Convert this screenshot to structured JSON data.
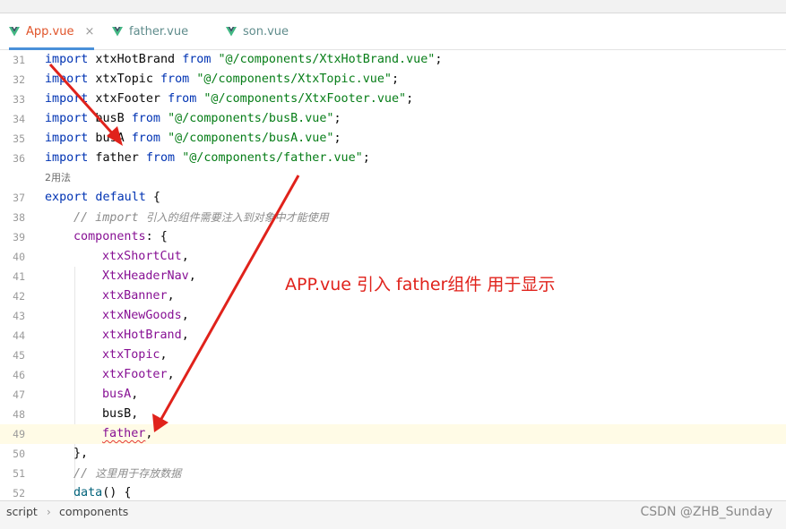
{
  "tabs": [
    {
      "label": "App.vue",
      "active": true,
      "close": "×"
    },
    {
      "label": "father.vue",
      "active": false
    },
    {
      "label": "son.vue",
      "active": false
    }
  ],
  "code": {
    "l31": {
      "num": "31",
      "kw": "import",
      "id": " xtxHotBrand ",
      "from": "from",
      "str": "\"@/components/XtxHotBrand.vue\"",
      "end": ";"
    },
    "l32": {
      "num": "32",
      "kw": "import",
      "id": " xtxTopic ",
      "from": "from",
      "str": "\"@/components/XtxTopic.vue\"",
      "end": ";"
    },
    "l33": {
      "num": "33",
      "kw": "import",
      "id": " xtxFooter ",
      "from": "from",
      "str": "\"@/components/XtxFooter.vue\"",
      "end": ";"
    },
    "l34": {
      "num": "34",
      "kw": "import",
      "id": " busB ",
      "from": "from",
      "str": "\"@/components/busB.vue\"",
      "end": ";"
    },
    "l35": {
      "num": "35",
      "kw": "import",
      "id": " busA ",
      "from": "from",
      "str": "\"@/components/busA.vue\"",
      "end": ";"
    },
    "l36": {
      "num": "36",
      "kw": "import",
      "id": " father ",
      "from": "from",
      "str": "\"@/components/father.vue\"",
      "end": ";"
    },
    "usages": "2用法",
    "l37": {
      "num": "37",
      "kw1": "export",
      "kw2": " default",
      "rest": " {"
    },
    "l38": {
      "num": "38",
      "comment": "// import ",
      "comment_zh": "引入的组件需要注入到对象中才能使用"
    },
    "l39": {
      "num": "39",
      "prop": "components",
      "rest": ": {"
    },
    "l40": {
      "num": "40",
      "name": "xtxShortCut",
      "sep": ","
    },
    "l41": {
      "num": "41",
      "name": "XtxHeaderNav",
      "sep": ","
    },
    "l42": {
      "num": "42",
      "name": "xtxBanner",
      "sep": ","
    },
    "l43": {
      "num": "43",
      "name": "xtxNewGoods",
      "sep": ","
    },
    "l44": {
      "num": "44",
      "name": "xtxHotBrand",
      "sep": ","
    },
    "l45": {
      "num": "45",
      "name": "xtxTopic",
      "sep": ","
    },
    "l46": {
      "num": "46",
      "name": "xtxFooter",
      "sep": ","
    },
    "l47": {
      "num": "47",
      "name": "busA",
      "sep": ","
    },
    "l48": {
      "num": "48",
      "name": "busB",
      "sep": ","
    },
    "l49": {
      "num": "49",
      "name": "father",
      "sep": ","
    },
    "l50": {
      "num": "50",
      "text": "},"
    },
    "l51": {
      "num": "51",
      "comment": "// ",
      "comment_zh": "这里用于存放数据"
    },
    "l52": {
      "num": "52",
      "fn": "data",
      "rest": "() {"
    }
  },
  "annotation": "APP.vue 引入 father组件 用于显示",
  "breadcrumb": {
    "items": [
      "script",
      "components"
    ],
    "separator": "›"
  },
  "watermark": "CSDN @ZHB_Sunday",
  "colors": {
    "accent_tab": "#e0542a",
    "vue_green": "#41b883",
    "arrow_red": "#e0221b",
    "keyword": "#0033b3",
    "string": "#067d17"
  }
}
